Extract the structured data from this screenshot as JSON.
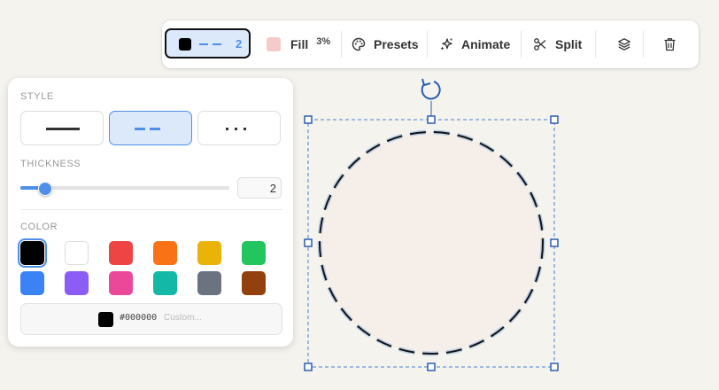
{
  "toolbar": {
    "stroke": {
      "color": "#000000",
      "width": "2",
      "style": "dashed"
    },
    "fill": {
      "label": "Fill",
      "opacity": "3%",
      "color": "#f7caca"
    },
    "presets_label": "Presets",
    "animate_label": "Animate",
    "split_label": "Split",
    "icons": [
      "palette-icon",
      "sparkles-icon",
      "scissors-icon",
      "layers-icon",
      "trash-icon"
    ]
  },
  "panel": {
    "style_label": "STYLE",
    "style_options": [
      "solid",
      "dashed",
      "dotted"
    ],
    "selected_style": "dashed",
    "thickness_label": "THICKNESS",
    "thickness_value": "2",
    "thickness_fraction": 0.12,
    "color_label": "COLOR",
    "colors": [
      "#000000",
      "#ffffff",
      "#ef4444",
      "#f97316",
      "#eab308",
      "#22c55e",
      "#3b82f6",
      "#8b5cf6",
      "#ec4899",
      "#14b8a6",
      "#6b7280",
      "#92400e"
    ],
    "selected_color": "#000000",
    "custom_hex": "#000000",
    "custom_placeholder": "Custom..."
  },
  "canvas": {
    "shape": "circle",
    "fill": "#f6eee8",
    "stroke": "#111111",
    "selection_color": "#2a5db0",
    "rotate_icon": "rotate-icon"
  }
}
